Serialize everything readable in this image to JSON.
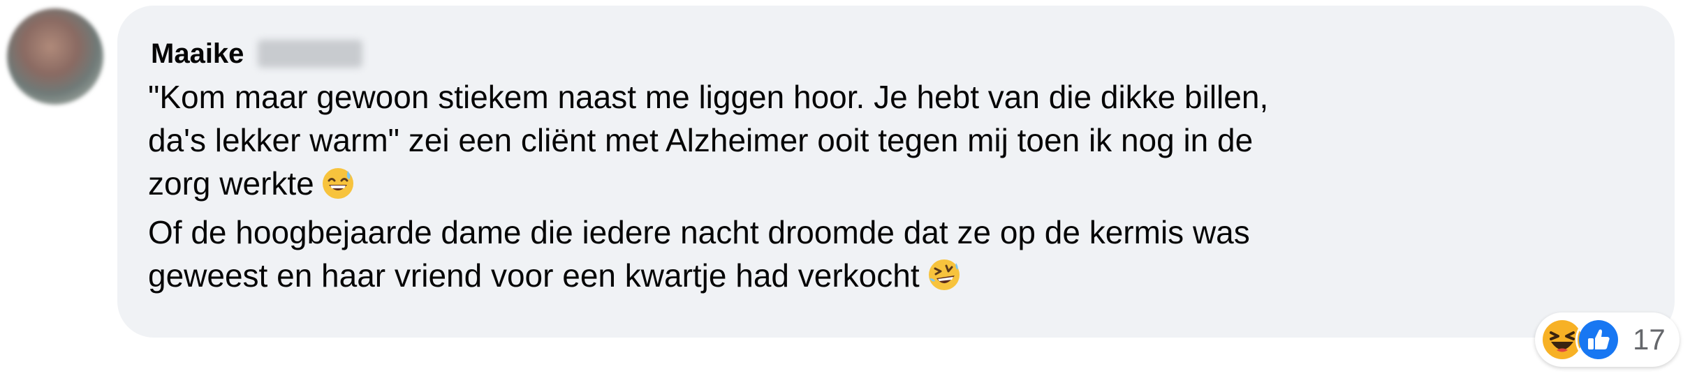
{
  "comment": {
    "author_first_name": "Maaike",
    "text_lines": [
      "\"Kom maar gewoon stiekem naast me liggen hoor. Je hebt van die dikke billen,",
      "da's lekker warm\" zei een cliënt met Alzheimer ooit tegen mij toen ik nog in de",
      "zorg werkte",
      "Of de hoogbejaarde dame die iedere nacht droomde dat ze op de kermis was",
      "geweest en haar vriend voor een kwartje had verkocht"
    ],
    "inline_emojis": [
      "grinning-sweat-emoji",
      "rofl-emoji"
    ]
  },
  "reactions": {
    "icons": [
      "haha-reaction-icon",
      "like-reaction-icon"
    ],
    "count": "17"
  },
  "colors": {
    "bubble_bg": "#f0f2f5",
    "text": "#050505",
    "secondary_text": "#65676b",
    "like_blue": "#1877f2",
    "haha_yellow": "#f7b125"
  }
}
